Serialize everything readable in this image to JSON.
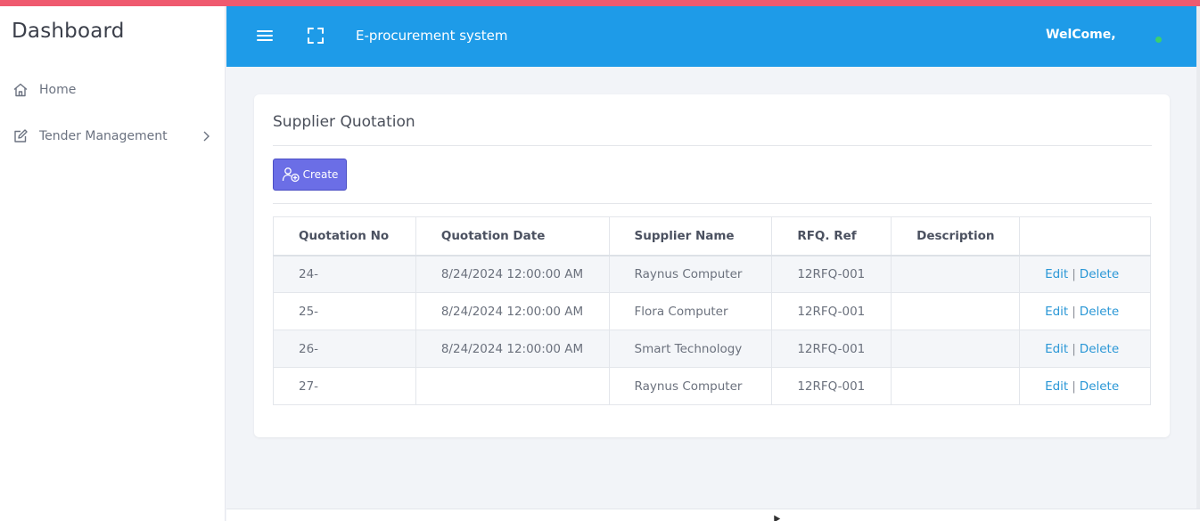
{
  "sidebar": {
    "brand": "Dashboard",
    "items": [
      {
        "label": "Home",
        "icon": "home-icon"
      },
      {
        "label": "Tender Management",
        "icon": "edit-icon"
      }
    ]
  },
  "topbar": {
    "title": "E-procurement system",
    "welcome": "WelCome,"
  },
  "page": {
    "title": "Supplier Quotation",
    "create_label": "Create"
  },
  "table": {
    "headers": [
      "Quotation No",
      "Quotation Date",
      "Supplier Name",
      "RFQ. Ref",
      "Description",
      ""
    ],
    "rows": [
      {
        "no": "24-",
        "date": "8/24/2024 12:00:00 AM",
        "supplier": "Raynus Computer",
        "rfq": "12RFQ-001",
        "description": ""
      },
      {
        "no": "25-",
        "date": "8/24/2024 12:00:00 AM",
        "supplier": "Flora Computer",
        "rfq": "12RFQ-001",
        "description": ""
      },
      {
        "no": "26-",
        "date": "8/24/2024 12:00:00 AM",
        "supplier": "Smart Technology",
        "rfq": "12RFQ-001",
        "description": ""
      },
      {
        "no": "27-",
        "date": "",
        "supplier": "Raynus Computer",
        "rfq": "12RFQ-001",
        "description": ""
      }
    ],
    "edit_label": "Edit",
    "separator": "|",
    "delete_label": "Delete"
  },
  "colors": {
    "accent": "#ef5a6f",
    "topbar": "#1e9be8",
    "create_button": "#6b6ee6",
    "link": "#2a97d6",
    "status_dot": "#3ccf6e"
  }
}
